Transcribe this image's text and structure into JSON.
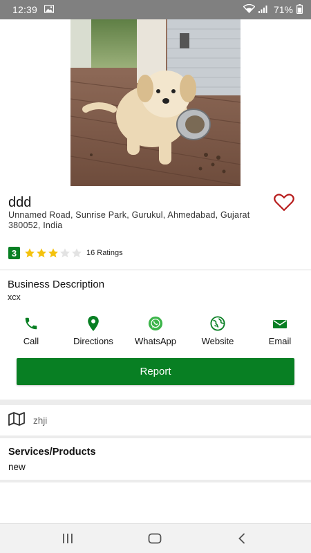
{
  "status_bar": {
    "time": "12:39",
    "battery": "71%"
  },
  "business": {
    "name": "ddd",
    "address": "Unnamed Road, Sunrise Park, Gurukul, Ahmedabad, Gujarat 380052, India",
    "rating_value": "3",
    "rating_stars_filled": 3,
    "rating_stars_total": 5,
    "ratings_count": "16 Ratings",
    "favorite_color": "#b71c1c"
  },
  "description": {
    "title": "Business Description",
    "text": "xcx"
  },
  "actions": [
    {
      "label": "Call",
      "icon": "phone-icon"
    },
    {
      "label": "Directions",
      "icon": "location-pin-icon"
    },
    {
      "label": "WhatsApp",
      "icon": "whatsapp-icon"
    },
    {
      "label": "Website",
      "icon": "globe-icon"
    },
    {
      "label": "Email",
      "icon": "email-icon"
    }
  ],
  "report_button": "Report",
  "map": {
    "text": "zhji",
    "icon": "map-icon"
  },
  "services": {
    "title": "Services/Products",
    "text": "new"
  },
  "colors": {
    "accent_green": "#087f23",
    "star_gold": "#f4c20d",
    "star_empty": "#e3e3e3",
    "status_bar": "#808080"
  }
}
